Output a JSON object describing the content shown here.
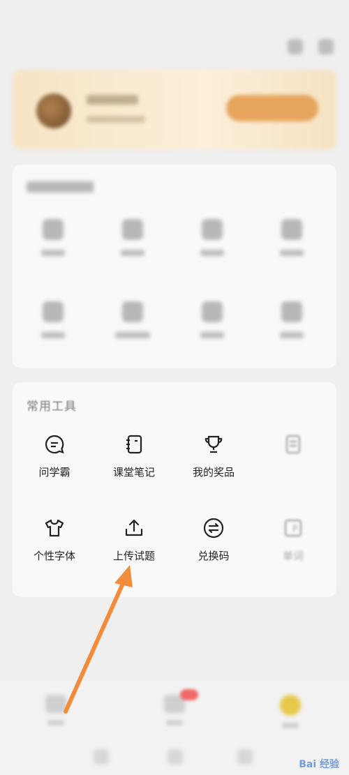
{
  "tools_card": {
    "title": "常用工具",
    "items": [
      {
        "label": "问学霸",
        "icon": "chat-bubble-icon"
      },
      {
        "label": "课堂笔记",
        "icon": "notebook-icon"
      },
      {
        "label": "我的奖品",
        "icon": "trophy-icon"
      },
      {
        "label": "",
        "icon": "document-icon"
      },
      {
        "label": "个性字体",
        "icon": "tshirt-icon"
      },
      {
        "label": "上传试题",
        "icon": "upload-icon"
      },
      {
        "label": "兑换码",
        "icon": "swap-icon"
      },
      {
        "label": "单词",
        "icon": "flashcard-icon"
      }
    ]
  },
  "annotation": {
    "color": "#f28c3b",
    "target": "上传试题"
  },
  "watermark": {
    "text": "Bai 经验"
  }
}
